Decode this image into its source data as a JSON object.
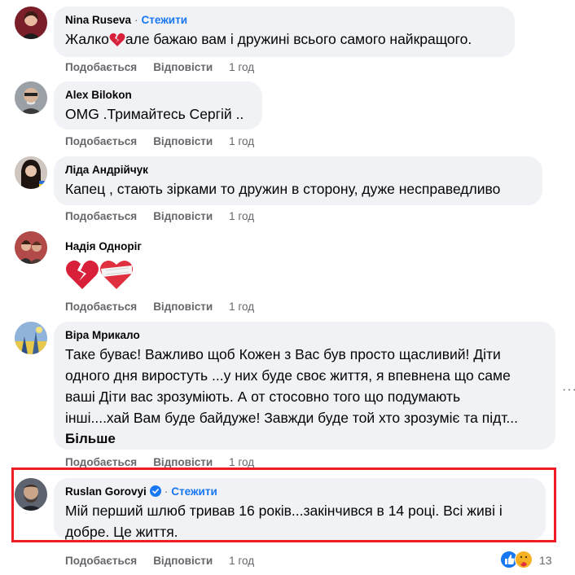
{
  "comments": [
    {
      "name": "Nina Ruseva",
      "separator": "·",
      "follow_label": "Стежити",
      "text_before": "Жалко",
      "text_after": "але бажаю вам і дружині всього самого найкращого.",
      "emoji": "broken-heart-icon",
      "like_label": "Подобається",
      "reply_label": "Відповісти",
      "time": "1 год"
    },
    {
      "name": "Alex Bilokon",
      "text": "OMG .Тримайтесь Сергій ..",
      "like_label": "Подобається",
      "reply_label": "Відповісти",
      "time": "1 год"
    },
    {
      "name": "Ліда Андрійчук",
      "text": "Капец , стають зірками то дружин в сторону, дуже несправедливо",
      "like_label": "Подобається",
      "reply_label": "Відповісти",
      "time": "1 год"
    },
    {
      "name": "Надія Одноріг",
      "emojis": [
        "broken-heart-icon",
        "bandaged-heart-icon"
      ],
      "like_label": "Подобається",
      "reply_label": "Відповісти",
      "time": "1 год"
    },
    {
      "name": "Віра Мрикало",
      "text_lines": [
        "Таке буває! Важливо щоб Кожен з Вас був просто щасливий! Діти",
        "одного дня виростуть ...у них буде своє життя, я впевнена що саме",
        "ваші Діти вас зрозуміють. А от стосовно того що подумають",
        "інші....хай Вам буде байдуже! Завжди буде той хто зрозуміє та підт..."
      ],
      "more_label": "Більше",
      "menu_icon": "more-options-icon",
      "like_label": "Подобається",
      "reply_label": "Відповісти",
      "time": "1 год"
    },
    {
      "name": "Ruslan Gorovyi",
      "verified_icon": "verified-badge-icon",
      "follow_label": "Стежити",
      "text_lines": [
        "Мій перший шлюб тривав 16 років...закінчився в 14 році. Всі живі і",
        "добре. Це життя."
      ],
      "like_label": "Подобається",
      "reply_label": "Відповісти",
      "time": "1 год",
      "reactions": {
        "icons": [
          "like-reaction-icon",
          "care-reaction-icon"
        ],
        "count": "13"
      }
    }
  ],
  "colors": {
    "bubble": "#f0f2f5",
    "follow": "#1877f2",
    "secondary_text": "#65676b",
    "highlight_border": "#ee1c25"
  }
}
